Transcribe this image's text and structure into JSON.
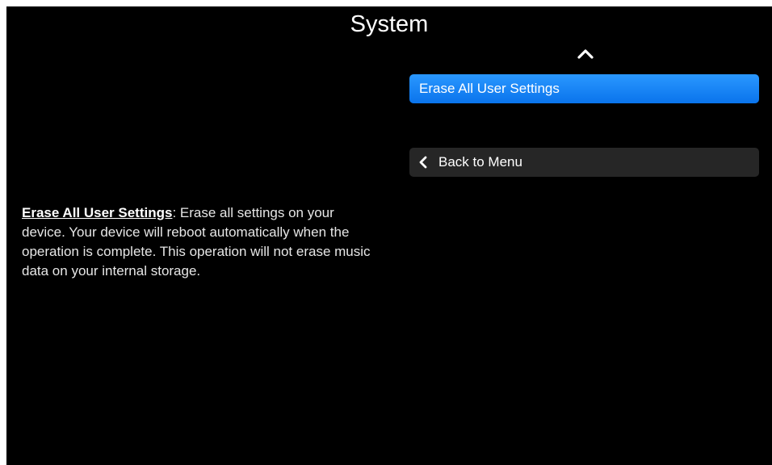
{
  "header": {
    "title": "System"
  },
  "menu": {
    "items": [
      {
        "label": "Erase All User Settings",
        "selected": true
      }
    ],
    "back_label": "Back to Menu"
  },
  "description": {
    "term": "Erase All User Settings",
    "text": ": Erase all settings on your device. Your device will reboot automatically when the operation is complete. This operation will not erase music data on your internal storage."
  },
  "icons": {
    "scroll_up": "chevron-up-icon",
    "back": "chevron-left-icon"
  },
  "colors": {
    "background": "#000000",
    "selected_item": "#1a86f7",
    "back_item": "#262626",
    "text": "#ffffff"
  }
}
